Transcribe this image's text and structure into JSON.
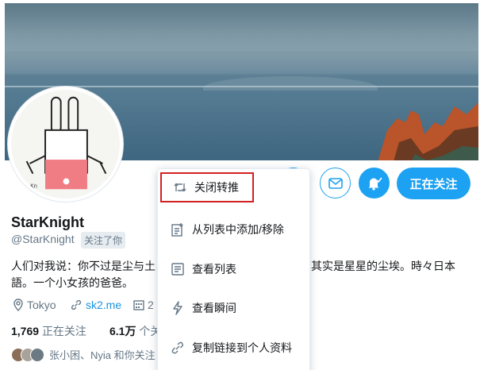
{
  "profile": {
    "name": "StarKnight",
    "handle": "@StarKnight",
    "follows_you": "关注了你",
    "bio_left": "人们对我说：你不过是尘与土",
    "bio_right": "其实是星星的尘埃。時々日本",
    "bio_line2": "語。一个小女孩的爸爸。",
    "location": "Tokyo",
    "website": "sk2.me",
    "joined_partial": "2",
    "following_count": "1,769",
    "following_label": "正在关注",
    "followers_count": "6.1万",
    "followers_label": "个关",
    "followers_you_know": "张小困、Nyia 和你关注"
  },
  "actions": {
    "follow_label": "正在关注",
    "mail_icon": "mail-icon",
    "bell_icon": "bell-icon"
  },
  "menu": {
    "items": [
      {
        "label": "关闭转推",
        "icon": "retweet-icon"
      },
      {
        "label": "从列表中添加/移除",
        "icon": "list-add-icon"
      },
      {
        "label": "查看列表",
        "icon": "list-icon"
      },
      {
        "label": "查看瞬间",
        "icon": "lightning-icon"
      },
      {
        "label": "复制链接到个人资料",
        "icon": "link-icon"
      }
    ]
  },
  "colors": {
    "accent": "#1da1f2",
    "highlight_box": "#d32020"
  }
}
